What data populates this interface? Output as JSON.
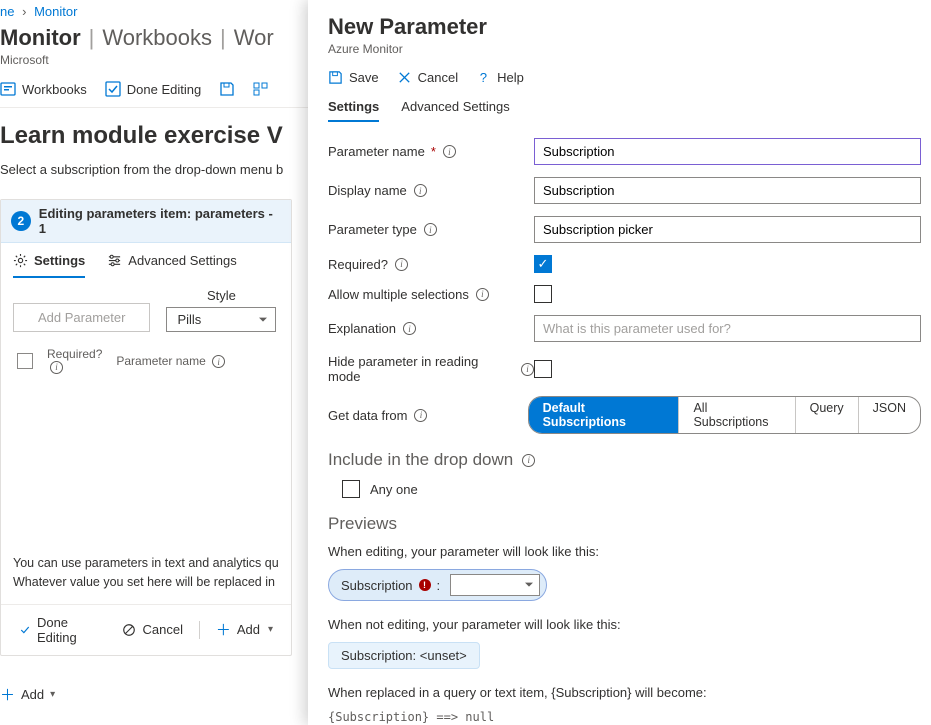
{
  "breadcrumb": {
    "item1": "ne",
    "item2": "Monitor"
  },
  "pageTitle": {
    "service": "Monitor",
    "section1": "Workbooks",
    "section2": "Wor"
  },
  "tenant": "Microsoft",
  "toolbar": {
    "workbooks": "Workbooks",
    "doneEditing": "Done Editing"
  },
  "heading": "Learn module exercise V",
  "subheading": "Select a subscription from the drop-down menu b",
  "card": {
    "step": "2",
    "title": "Editing parameters item: parameters - 1",
    "tabs": {
      "settings": "Settings",
      "advanced": "Advanced Settings"
    },
    "addParam": "Add Parameter",
    "styleLabel": "Style",
    "styleValue": "Pills",
    "cols": {
      "required": "Required?",
      "paramName": "Parameter name"
    },
    "help1": "You can use parameters in text and analytics qu",
    "help2": "Whatever value you set here will be replaced in",
    "footer": {
      "done": "Done Editing",
      "cancel": "Cancel",
      "add": "Add"
    }
  },
  "bottomAdd": "Add",
  "panel": {
    "title": "New Parameter",
    "sub": "Azure Monitor",
    "actions": {
      "save": "Save",
      "cancel": "Cancel",
      "help": "Help"
    },
    "tabs": {
      "settings": "Settings",
      "advanced": "Advanced Settings"
    },
    "fields": {
      "paramName": {
        "label": "Parameter name",
        "value": "Subscription"
      },
      "displayName": {
        "label": "Display name",
        "value": "Subscription"
      },
      "paramType": {
        "label": "Parameter type",
        "value": "Subscription picker"
      },
      "required": {
        "label": "Required?"
      },
      "allowMultiple": {
        "label": "Allow multiple selections"
      },
      "explanation": {
        "label": "Explanation",
        "placeholder": "What is this parameter used for?"
      },
      "hideReading": {
        "label": "Hide parameter in reading mode"
      },
      "getData": {
        "label": "Get data from",
        "options": [
          "Default Subscriptions",
          "All Subscriptions",
          "Query",
          "JSON"
        ]
      }
    },
    "include": {
      "title": "Include in the drop down",
      "anyOne": "Any one"
    },
    "previews": {
      "title": "Previews",
      "editingText": "When editing, your parameter will look like this:",
      "pillLabel": "Subscription",
      "notEditingText": "When not editing, your parameter will look like this:",
      "staticPill": "Subscription: <unset>",
      "replacedText": "When replaced in a query or text item, {Subscription} will become:",
      "code": "{Subscription} ==> null"
    }
  }
}
